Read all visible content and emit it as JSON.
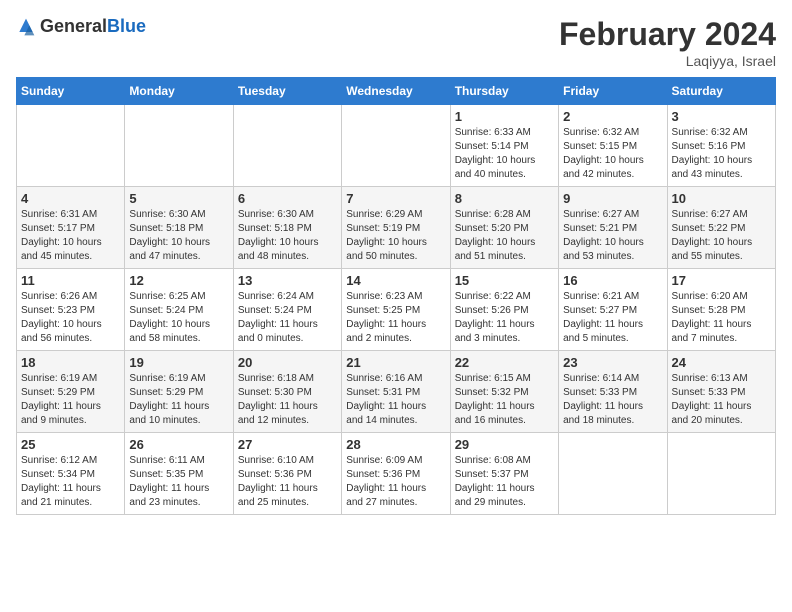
{
  "header": {
    "logo_general": "General",
    "logo_blue": "Blue",
    "month_title": "February 2024",
    "location": "Laqiyya, Israel"
  },
  "days_of_week": [
    "Sunday",
    "Monday",
    "Tuesday",
    "Wednesday",
    "Thursday",
    "Friday",
    "Saturday"
  ],
  "weeks": [
    [
      {
        "day": "",
        "info": ""
      },
      {
        "day": "",
        "info": ""
      },
      {
        "day": "",
        "info": ""
      },
      {
        "day": "",
        "info": ""
      },
      {
        "day": "1",
        "info": "Sunrise: 6:33 AM\nSunset: 5:14 PM\nDaylight: 10 hours\nand 40 minutes."
      },
      {
        "day": "2",
        "info": "Sunrise: 6:32 AM\nSunset: 5:15 PM\nDaylight: 10 hours\nand 42 minutes."
      },
      {
        "day": "3",
        "info": "Sunrise: 6:32 AM\nSunset: 5:16 PM\nDaylight: 10 hours\nand 43 minutes."
      }
    ],
    [
      {
        "day": "4",
        "info": "Sunrise: 6:31 AM\nSunset: 5:17 PM\nDaylight: 10 hours\nand 45 minutes."
      },
      {
        "day": "5",
        "info": "Sunrise: 6:30 AM\nSunset: 5:18 PM\nDaylight: 10 hours\nand 47 minutes."
      },
      {
        "day": "6",
        "info": "Sunrise: 6:30 AM\nSunset: 5:18 PM\nDaylight: 10 hours\nand 48 minutes."
      },
      {
        "day": "7",
        "info": "Sunrise: 6:29 AM\nSunset: 5:19 PM\nDaylight: 10 hours\nand 50 minutes."
      },
      {
        "day": "8",
        "info": "Sunrise: 6:28 AM\nSunset: 5:20 PM\nDaylight: 10 hours\nand 51 minutes."
      },
      {
        "day": "9",
        "info": "Sunrise: 6:27 AM\nSunset: 5:21 PM\nDaylight: 10 hours\nand 53 minutes."
      },
      {
        "day": "10",
        "info": "Sunrise: 6:27 AM\nSunset: 5:22 PM\nDaylight: 10 hours\nand 55 minutes."
      }
    ],
    [
      {
        "day": "11",
        "info": "Sunrise: 6:26 AM\nSunset: 5:23 PM\nDaylight: 10 hours\nand 56 minutes."
      },
      {
        "day": "12",
        "info": "Sunrise: 6:25 AM\nSunset: 5:24 PM\nDaylight: 10 hours\nand 58 minutes."
      },
      {
        "day": "13",
        "info": "Sunrise: 6:24 AM\nSunset: 5:24 PM\nDaylight: 11 hours\nand 0 minutes."
      },
      {
        "day": "14",
        "info": "Sunrise: 6:23 AM\nSunset: 5:25 PM\nDaylight: 11 hours\nand 2 minutes."
      },
      {
        "day": "15",
        "info": "Sunrise: 6:22 AM\nSunset: 5:26 PM\nDaylight: 11 hours\nand 3 minutes."
      },
      {
        "day": "16",
        "info": "Sunrise: 6:21 AM\nSunset: 5:27 PM\nDaylight: 11 hours\nand 5 minutes."
      },
      {
        "day": "17",
        "info": "Sunrise: 6:20 AM\nSunset: 5:28 PM\nDaylight: 11 hours\nand 7 minutes."
      }
    ],
    [
      {
        "day": "18",
        "info": "Sunrise: 6:19 AM\nSunset: 5:29 PM\nDaylight: 11 hours\nand 9 minutes."
      },
      {
        "day": "19",
        "info": "Sunrise: 6:19 AM\nSunset: 5:29 PM\nDaylight: 11 hours\nand 10 minutes."
      },
      {
        "day": "20",
        "info": "Sunrise: 6:18 AM\nSunset: 5:30 PM\nDaylight: 11 hours\nand 12 minutes."
      },
      {
        "day": "21",
        "info": "Sunrise: 6:16 AM\nSunset: 5:31 PM\nDaylight: 11 hours\nand 14 minutes."
      },
      {
        "day": "22",
        "info": "Sunrise: 6:15 AM\nSunset: 5:32 PM\nDaylight: 11 hours\nand 16 minutes."
      },
      {
        "day": "23",
        "info": "Sunrise: 6:14 AM\nSunset: 5:33 PM\nDaylight: 11 hours\nand 18 minutes."
      },
      {
        "day": "24",
        "info": "Sunrise: 6:13 AM\nSunset: 5:33 PM\nDaylight: 11 hours\nand 20 minutes."
      }
    ],
    [
      {
        "day": "25",
        "info": "Sunrise: 6:12 AM\nSunset: 5:34 PM\nDaylight: 11 hours\nand 21 minutes."
      },
      {
        "day": "26",
        "info": "Sunrise: 6:11 AM\nSunset: 5:35 PM\nDaylight: 11 hours\nand 23 minutes."
      },
      {
        "day": "27",
        "info": "Sunrise: 6:10 AM\nSunset: 5:36 PM\nDaylight: 11 hours\nand 25 minutes."
      },
      {
        "day": "28",
        "info": "Sunrise: 6:09 AM\nSunset: 5:36 PM\nDaylight: 11 hours\nand 27 minutes."
      },
      {
        "day": "29",
        "info": "Sunrise: 6:08 AM\nSunset: 5:37 PM\nDaylight: 11 hours\nand 29 minutes."
      },
      {
        "day": "",
        "info": ""
      },
      {
        "day": "",
        "info": ""
      }
    ]
  ]
}
